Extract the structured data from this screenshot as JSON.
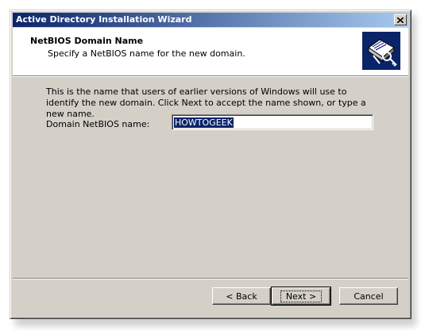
{
  "window": {
    "title": "Active Directory Installation Wizard"
  },
  "header": {
    "title": "NetBIOS Domain Name",
    "subtitle": "Specify a NetBIOS name for the new domain.",
    "icon": "wizard-book-icon"
  },
  "content": {
    "description": "This is the name that users of earlier versions of Windows will use to identify the new domain. Click Next to accept the name shown, or type a new name.",
    "field_label": "Domain NetBIOS name:",
    "field_value": "HOWTOGEEK"
  },
  "buttons": {
    "back": "< Back",
    "next": "Next >",
    "cancel": "Cancel"
  },
  "colors": {
    "titlebar_start": "#0a246a",
    "titlebar_end": "#a6caf0",
    "dialog_face": "#d4d0c8",
    "selection": "#0a246a"
  }
}
